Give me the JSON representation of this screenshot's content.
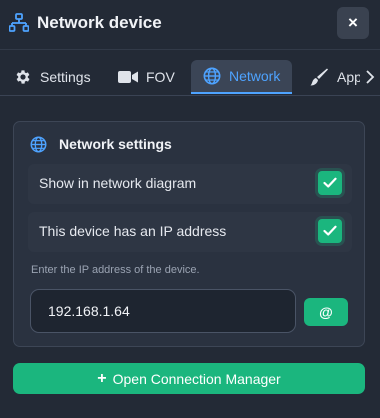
{
  "header": {
    "title": "Network device",
    "close_label": "×"
  },
  "tabs": [
    {
      "label": "Settings",
      "icon": "gear-icon"
    },
    {
      "label": "FOV",
      "icon": "camera-icon"
    },
    {
      "label": "Network",
      "icon": "globe-icon",
      "active": true
    },
    {
      "label": "Appeara",
      "icon": "brush-icon"
    }
  ],
  "card": {
    "title": "Network settings",
    "options": [
      {
        "label": "Show in network diagram",
        "checked": true
      },
      {
        "label": "This device has an IP address",
        "checked": true
      }
    ],
    "hint": "Enter the IP address of the device.",
    "ip_value": "192.168.1.64",
    "at_button_label": "@"
  },
  "footer": {
    "plus_label": "+",
    "button_label": "Open Connection Manager"
  },
  "colors": {
    "accent_green": "#1bb67e",
    "accent_blue": "#4ea3ff",
    "background": "#232a36"
  }
}
